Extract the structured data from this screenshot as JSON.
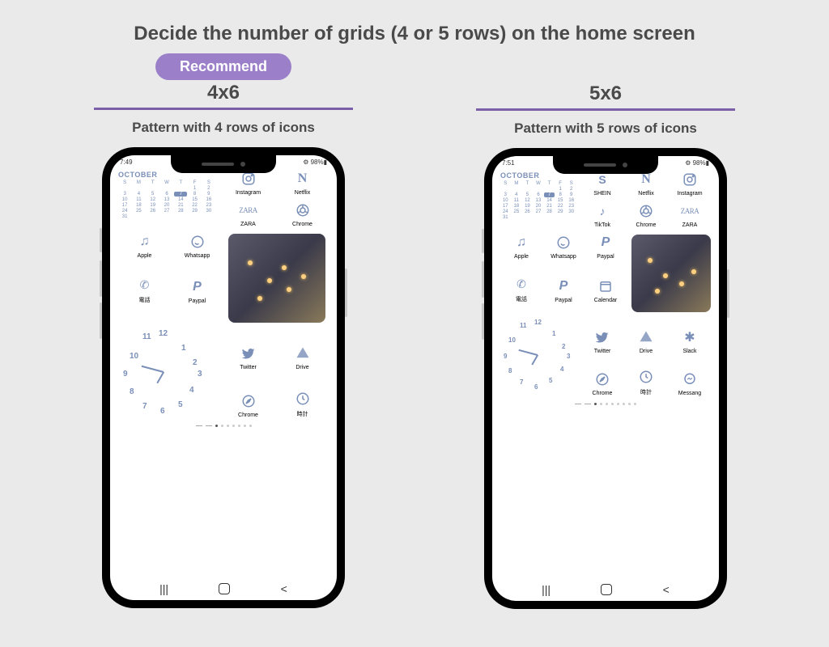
{
  "title": "Decide the number of grids (4 or 5 rows) on the home screen",
  "recommend": "Recommend",
  "left": {
    "grid": "4x6",
    "pattern": "Pattern with 4 rows of icons",
    "status_time": "7:49",
    "status_right": "⚙ 98%▮",
    "month": "OCTOBER",
    "apps_r1": [
      {
        "icon": "instagram",
        "label": "Instagram"
      },
      {
        "icon": "netflix",
        "label": "Netflix"
      }
    ],
    "apps_r2": [
      {
        "icon": "zara",
        "label": "ZARA"
      },
      {
        "icon": "chrome",
        "label": "Chrome"
      }
    ],
    "apps_r3": [
      {
        "icon": "music",
        "label": "Apple"
      },
      {
        "icon": "whatsapp",
        "label": "Whatsapp"
      }
    ],
    "apps_r4": [
      {
        "icon": "phone",
        "label": "電話"
      },
      {
        "icon": "paypal",
        "label": "Paypal"
      }
    ],
    "apps_r5": [
      {
        "icon": "twitter",
        "label": "Twitter"
      },
      {
        "icon": "drive",
        "label": "Drive"
      }
    ],
    "apps_r6": [
      {
        "icon": "compass",
        "label": "Chrome"
      },
      {
        "icon": "clock",
        "label": "時計"
      }
    ]
  },
  "right": {
    "grid": "5x6",
    "pattern": "Pattern with 5 rows of icons",
    "status_time": "7:51",
    "status_right": "⚙ 98%▮",
    "month": "OCTOBER",
    "apps_r1": [
      {
        "icon": "shein",
        "label": "SHEIN"
      },
      {
        "icon": "netflix",
        "label": "Netflix"
      },
      {
        "icon": "instagram",
        "label": "Instagram"
      }
    ],
    "apps_r2": [
      {
        "icon": "tiktok",
        "label": "TikTok"
      },
      {
        "icon": "chrome",
        "label": "Chrome"
      },
      {
        "icon": "zara",
        "label": "ZARA"
      }
    ],
    "apps_r3": [
      {
        "icon": "music",
        "label": "Apple"
      },
      {
        "icon": "whatsapp",
        "label": "Whatsapp"
      },
      {
        "icon": "paypal",
        "label": "Paypal"
      }
    ],
    "apps_r4": [
      {
        "icon": "phone",
        "label": "電話"
      },
      {
        "icon": "paypal",
        "label": "Paypal"
      },
      {
        "icon": "calendar",
        "label": "Calendar"
      }
    ],
    "apps_r5": [
      {
        "icon": "twitter",
        "label": "Twitter"
      },
      {
        "icon": "drive",
        "label": "Drive"
      },
      {
        "icon": "slack",
        "label": "Slack"
      }
    ],
    "apps_r6": [
      {
        "icon": "compass",
        "label": "Chrome"
      },
      {
        "icon": "clock",
        "label": "時計"
      },
      {
        "icon": "messenger",
        "label": "Messang"
      }
    ]
  },
  "calendar_days": [
    "S",
    "M",
    "T",
    "W",
    "T",
    "F",
    "S"
  ],
  "calendar_dates": [
    "",
    "",
    "",
    "",
    "",
    "1",
    "2",
    "3",
    "4",
    "5",
    "6",
    "7",
    "8",
    "9",
    "10",
    "11",
    "12",
    "13",
    "14",
    "15",
    "16",
    "17",
    "18",
    "19",
    "20",
    "21",
    "22",
    "23",
    "24",
    "25",
    "26",
    "27",
    "28",
    "29",
    "30",
    "31",
    "",
    "",
    "",
    "",
    "",
    ""
  ],
  "calendar_highlight": "7"
}
